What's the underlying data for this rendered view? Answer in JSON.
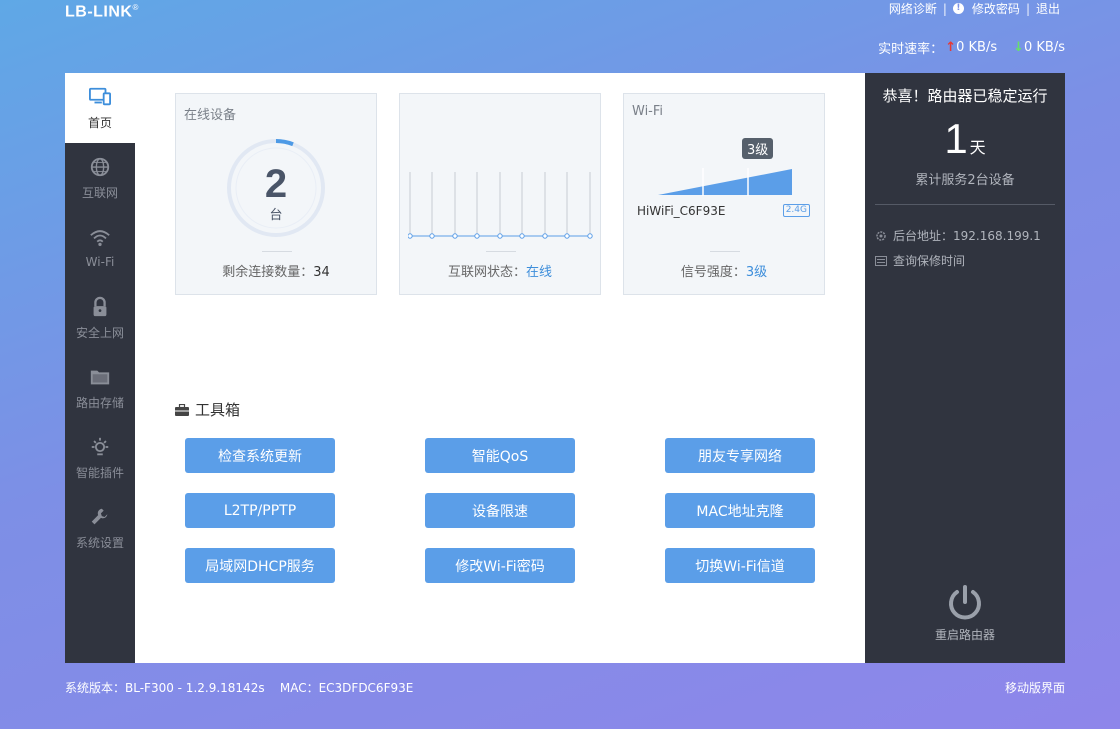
{
  "header": {
    "logo": "LB-LINK",
    "logo_mark": "®",
    "links": {
      "diagnose": "网络诊断",
      "change_password": "修改密码",
      "logout": "退出",
      "sep": "|"
    },
    "speed": {
      "label": "实时速率：",
      "up_arrow": "↑",
      "up": "0 KB/s",
      "down_arrow": "↓",
      "down": "0 KB/s"
    }
  },
  "sidebar": {
    "items": [
      {
        "label": "首页",
        "icon": "monitor-icon"
      },
      {
        "label": "互联网",
        "icon": "globe-icon"
      },
      {
        "label": "Wi-Fi",
        "icon": "wifi-icon"
      },
      {
        "label": "安全上网",
        "icon": "lock-icon"
      },
      {
        "label": "路由存储",
        "icon": "folder-icon"
      },
      {
        "label": "智能插件",
        "icon": "bulb-icon"
      },
      {
        "label": "系统设置",
        "icon": "wrench-icon"
      }
    ]
  },
  "cards": {
    "devices": {
      "title": "在线设备",
      "count": "2",
      "unit": "台",
      "remaining_label": "剩余连接数量：",
      "remaining_value": "34"
    },
    "internet": {
      "status_label": "互联网状态：",
      "status_value": "在线"
    },
    "wifi": {
      "title": "Wi-Fi",
      "level": "3级",
      "ssid": "HiWiFi_C6F93E",
      "band": "2.4G",
      "signal_label": "信号强度：",
      "signal_value": "3级"
    }
  },
  "toolbox": {
    "title": "工具箱",
    "buttons": [
      "检查系统更新",
      "智能QoS",
      "朋友专享网络",
      "L2TP/PPTP",
      "设备限速",
      "MAC地址克隆",
      "局域网DHCP服务",
      "修改Wi-Fi密码",
      "切换Wi-Fi信道"
    ]
  },
  "right_panel": {
    "congrats": "恭喜！路由器已稳定运行",
    "days": "1",
    "days_unit": "天",
    "served": "累计服务2台设备",
    "admin_address": "后台地址：192.168.199.1",
    "warranty": "查询保修时间",
    "reboot": "重启路由器"
  },
  "footer": {
    "version": "系统版本：BL-F300 - 1.2.9.18142s",
    "mac": "MAC：EC3DFDC6F93E",
    "mobile": "移动版界面"
  },
  "colors": {
    "accent": "#5b9ee8",
    "sidebar_bg": "#30343f",
    "link_blue": "#3d8edb",
    "up_red": "#e53935",
    "down_green": "#66e06a"
  }
}
